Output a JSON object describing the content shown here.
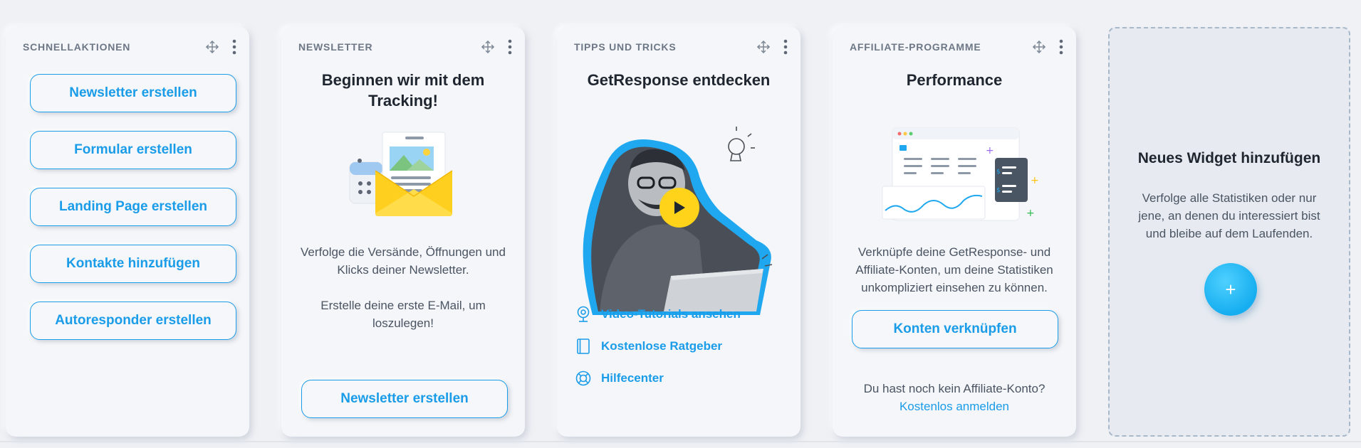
{
  "quick_actions": {
    "title": "SCHNELLAKTIONEN",
    "buttons": [
      "Newsletter erstellen",
      "Formular erstellen",
      "Landing Page erstellen",
      "Kontakte hinzufügen",
      "Autoresponder erstellen"
    ]
  },
  "newsletter": {
    "title": "NEWSLETTER",
    "heading": "Beginnen wir mit dem Tracking!",
    "text1": "Verfolge die Versände, Öffnungen und Klicks deiner Newsletter.",
    "text2": "Erstelle deine erste E-Mail, um loszulegen!",
    "button": "Newsletter erstellen",
    "illustration_icon": "newsletter-envelope-illustration"
  },
  "tips": {
    "title": "TIPPS UND TRICKS",
    "heading": "GetResponse entdecken",
    "video_icon": "play-icon",
    "links": [
      {
        "label": "Video-Tutorials ansehen",
        "icon": "webcam-icon"
      },
      {
        "label": "Kostenlose Ratgeber",
        "icon": "book-icon"
      },
      {
        "label": "Hilfecenter",
        "icon": "lifebuoy-icon"
      }
    ]
  },
  "affiliate": {
    "title": "AFFILIATE-PROGRAMME",
    "heading": "Performance",
    "text": "Verknüpfe deine GetResponse- und Affiliate-Konten, um deine Statistiken unkompliziert einsehen zu können.",
    "button": "Konten verknüpfen",
    "question": "Du hast noch kein Affiliate-Konto?",
    "signup_link": "Kostenlos anmelden",
    "illustration_icon": "dashboard-illustration"
  },
  "add_widget": {
    "heading": "Neues Widget hinzufügen",
    "text": "Verfolge alle Statistiken oder nur jene, an denen du interessiert bist und bleibe auf dem Laufenden.",
    "button": "+"
  },
  "colors": {
    "accent": "#1a9ce8",
    "card_bg": "#f4f6f9",
    "page_bg": "#eff1f5",
    "heading": "#1f2630"
  }
}
